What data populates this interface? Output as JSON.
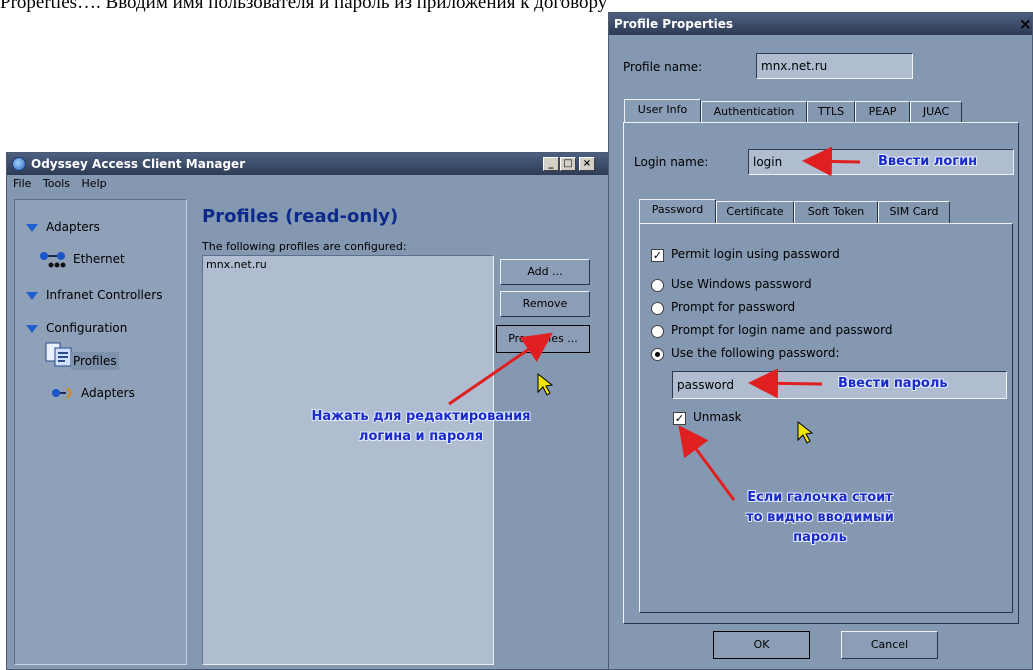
{
  "document": {
    "line": "Properties…. Вводим имя пользователя и пароль из приложения к договору"
  },
  "manager": {
    "title": "Odyssey Access Client Manager",
    "controls": [
      "_",
      "□",
      "×"
    ],
    "menu": [
      "File",
      "Tools",
      "Help"
    ],
    "tree": {
      "adapters": "Adapters",
      "ethernet": "Ethernet",
      "infranet": "Infranet Controllers",
      "configuration": "Configuration",
      "profiles": "Profiles",
      "adapters2": "Adapters"
    },
    "heading": "Profiles (read-only)",
    "subheading": "The following profiles are configured:",
    "profiles": [
      "mnx.net.ru"
    ],
    "buttons": {
      "add": "Add ...",
      "remove": "Remove",
      "properties": "Properties ..."
    }
  },
  "dialog": {
    "title": "Profile Properties",
    "close": "×",
    "profile_name_label": "Profile name:",
    "profile_name_value": "mnx.net.ru",
    "tabs": [
      "User Info",
      "Authentication",
      "TTLS",
      "PEAP",
      "JUAC"
    ],
    "login_label": "Login name:",
    "login_value": "login",
    "subtabs": [
      "Password",
      "Certificate",
      "Soft Token",
      "SIM Card"
    ],
    "permit_login": "Permit login using password",
    "permit_checked": true,
    "radio_options": [
      "Use Windows password",
      "Prompt for password",
      "Prompt for login name and password",
      "Use the following password:"
    ],
    "radio_selected": 3,
    "password_value": "password",
    "unmask_label": "Unmask",
    "unmask_checked": true,
    "ok": "OK",
    "cancel": "Cancel"
  },
  "annotations": {
    "login": "Ввести логин",
    "password": "Ввести пароль",
    "properties_line1": "Нажать для редактирования",
    "properties_line2": "логина и пароля",
    "unmask_line1": "Если галочка стоит",
    "unmask_line2": "то видно вводимый",
    "unmask_line3": "пароль",
    "arrow_color": "#e02020",
    "text_color": "#1b2bc8"
  }
}
